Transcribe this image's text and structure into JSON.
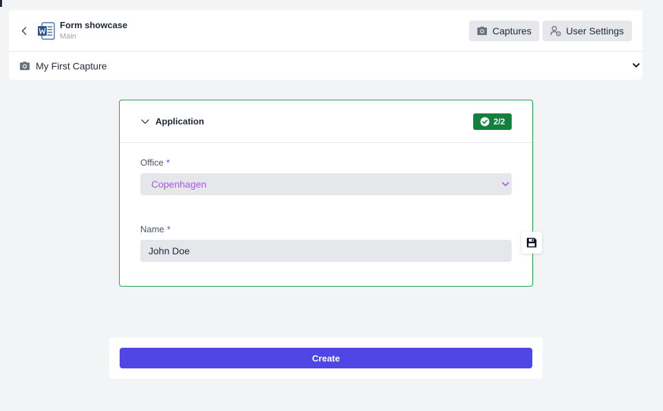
{
  "app": {
    "title": "Form showcase",
    "subtitle": "Main"
  },
  "toolbar": {
    "captures_label": "Captures",
    "user_settings_label": "User Settings"
  },
  "capture": {
    "name": "My First Capture"
  },
  "section": {
    "title": "Application",
    "status": "2/2",
    "status_color": "#15803d"
  },
  "fields": {
    "office": {
      "label": "Office",
      "required_mark": "*",
      "value": "Copenhagen"
    },
    "name": {
      "label": "Name",
      "required_mark": "*",
      "value": "John Doe"
    }
  },
  "actions": {
    "create_label": "Create"
  },
  "colors": {
    "accent": "#4f46e5",
    "success": "#15803d",
    "select_text": "#a855f7",
    "background": "#f3f4f6"
  }
}
